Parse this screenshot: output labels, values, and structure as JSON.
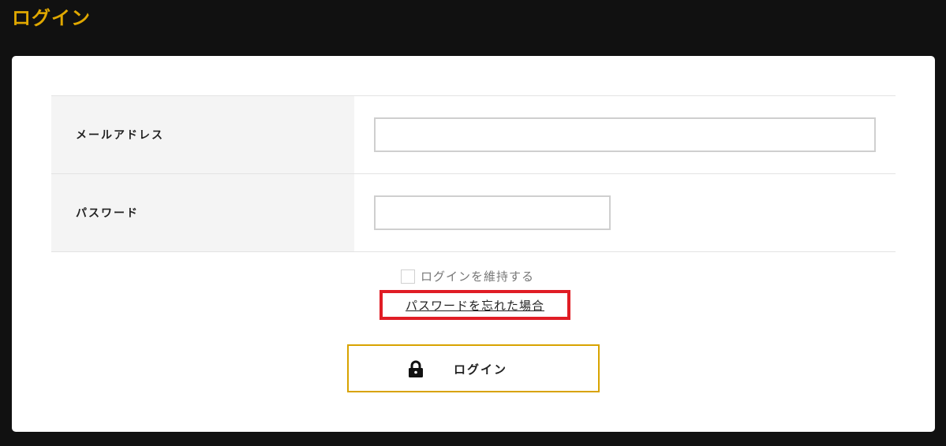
{
  "header": {
    "title": "ログイン"
  },
  "form": {
    "email": {
      "label": "メールアドレス",
      "value": "",
      "placeholder": ""
    },
    "password": {
      "label": "パスワード",
      "value": "",
      "placeholder": ""
    }
  },
  "remember": {
    "label": "ログインを維持する",
    "checked": false
  },
  "forgot": {
    "label": "パスワードを忘れた場合"
  },
  "submit": {
    "label": "ログイン",
    "icon": "lock-icon"
  },
  "colors": {
    "background": "#111111",
    "accent": "#e0a800",
    "highlight_box": "#e01d25",
    "card": "#ffffff"
  }
}
